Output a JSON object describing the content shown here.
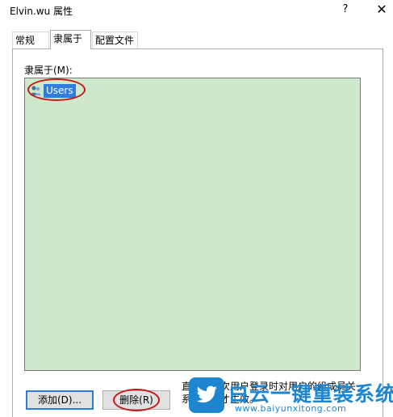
{
  "window": {
    "title": "Elvin.wu 属性",
    "help_glyph": "?",
    "close_glyph": "✕"
  },
  "tabs": [
    {
      "label": "常规",
      "active": false
    },
    {
      "label": "隶属于",
      "active": true
    },
    {
      "label": "配置文件",
      "active": false
    }
  ],
  "member_of": {
    "label": "隶属于(M):",
    "items": [
      {
        "label": "Users",
        "icon": "user-group-icon",
        "selected": true
      }
    ]
  },
  "buttons": {
    "add": "添加(D)...",
    "remove": "删除(R)"
  },
  "note": {
    "line1": "直到下一次用户登录时对用户的组成员关",
    "line2": "系的更改才生效。"
  },
  "watermark": {
    "name": "白云一键重装系统",
    "url": "www.baiyunxitong.com",
    "icon": "twitter-bird-icon"
  },
  "colors": {
    "list_bg": "#cde8cb",
    "selection": "#2f7ddf",
    "highlight_circle": "#c41818",
    "watermark": "#1d86cf"
  }
}
